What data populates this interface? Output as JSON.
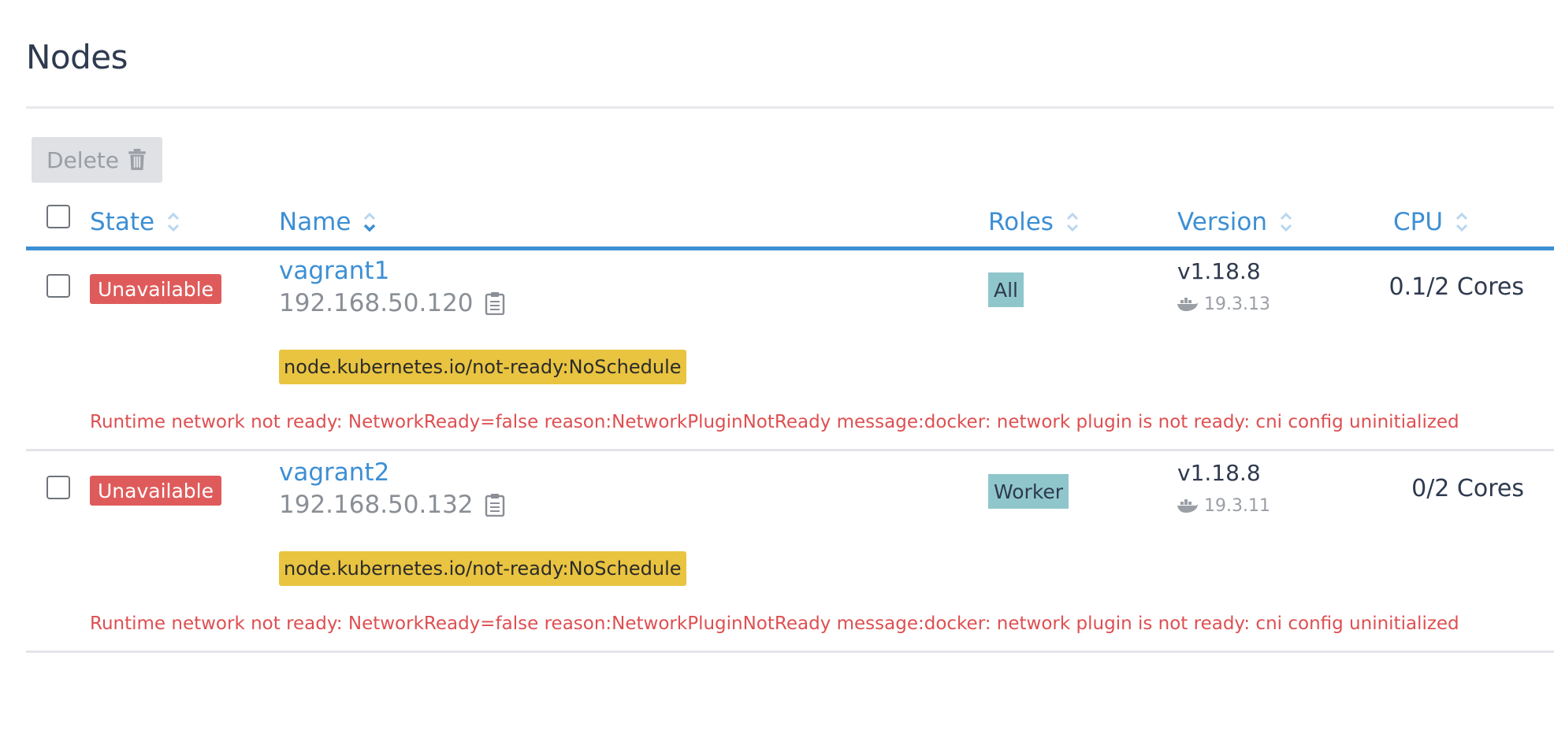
{
  "page": {
    "title": "Nodes"
  },
  "toolbar": {
    "delete_label": "Delete"
  },
  "table": {
    "headers": {
      "state": "State",
      "name": "Name",
      "roles": "Roles",
      "version": "Version",
      "cpu": "CPU"
    },
    "sort": {
      "column": "name",
      "direction": "ascending"
    },
    "rows": [
      {
        "state": "Unavailable",
        "name": "vagrant1",
        "ip": "192.168.50.120",
        "taint": "node.kubernetes.io/not-ready:NoSchedule",
        "roles": "All",
        "k8s_version": "v1.18.8",
        "docker_version": "19.3.13",
        "cpu": "0.1/2 Cores",
        "message": "Runtime network not ready: NetworkReady=false reason:NetworkPluginNotReady message:docker: network plugin is not ready: cni config uninitialized"
      },
      {
        "state": "Unavailable",
        "name": "vagrant2",
        "ip": "192.168.50.132",
        "taint": "node.kubernetes.io/not-ready:NoSchedule",
        "roles": "Worker",
        "k8s_version": "v1.18.8",
        "docker_version": "19.3.11",
        "cpu": "0/2 Cores",
        "message": "Runtime network not ready: NetworkReady=false reason:NetworkPluginNotReady message:docker: network plugin is not ready: cni config uninitialized"
      }
    ]
  },
  "colors": {
    "accent": "#3d8fd4",
    "unavailable": "#df5b5b",
    "taint": "#e9c440",
    "role": "#8fc6cc",
    "error_text": "#de4f51"
  },
  "icons": {
    "delete": "trash-icon",
    "sort": "sort-icon",
    "copy": "clipboard-icon",
    "docker": "docker-icon"
  }
}
